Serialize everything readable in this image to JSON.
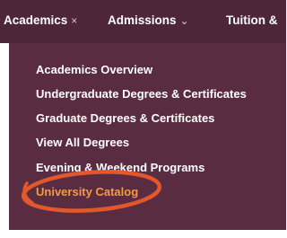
{
  "nav": {
    "items": [
      {
        "label": "Academics",
        "symbol": "×"
      },
      {
        "label": "Admissions",
        "symbol": "⌄"
      },
      {
        "label": "Tuition &",
        "symbol": ""
      }
    ]
  },
  "dropdown": {
    "items": [
      {
        "label": "Academics Overview"
      },
      {
        "label": "Undergraduate Degrees & Certificates"
      },
      {
        "label": "Graduate Degrees & Certificates"
      },
      {
        "label": "View All Degrees"
      },
      {
        "label": "Evening & Weekend Programs"
      },
      {
        "label": "University Catalog",
        "highlighted": true
      }
    ]
  },
  "colors": {
    "nav_background": "#4e2639",
    "dropdown_background": "#5a2c42",
    "highlight_text": "#f39c3b",
    "annotation": "#e2582b"
  }
}
